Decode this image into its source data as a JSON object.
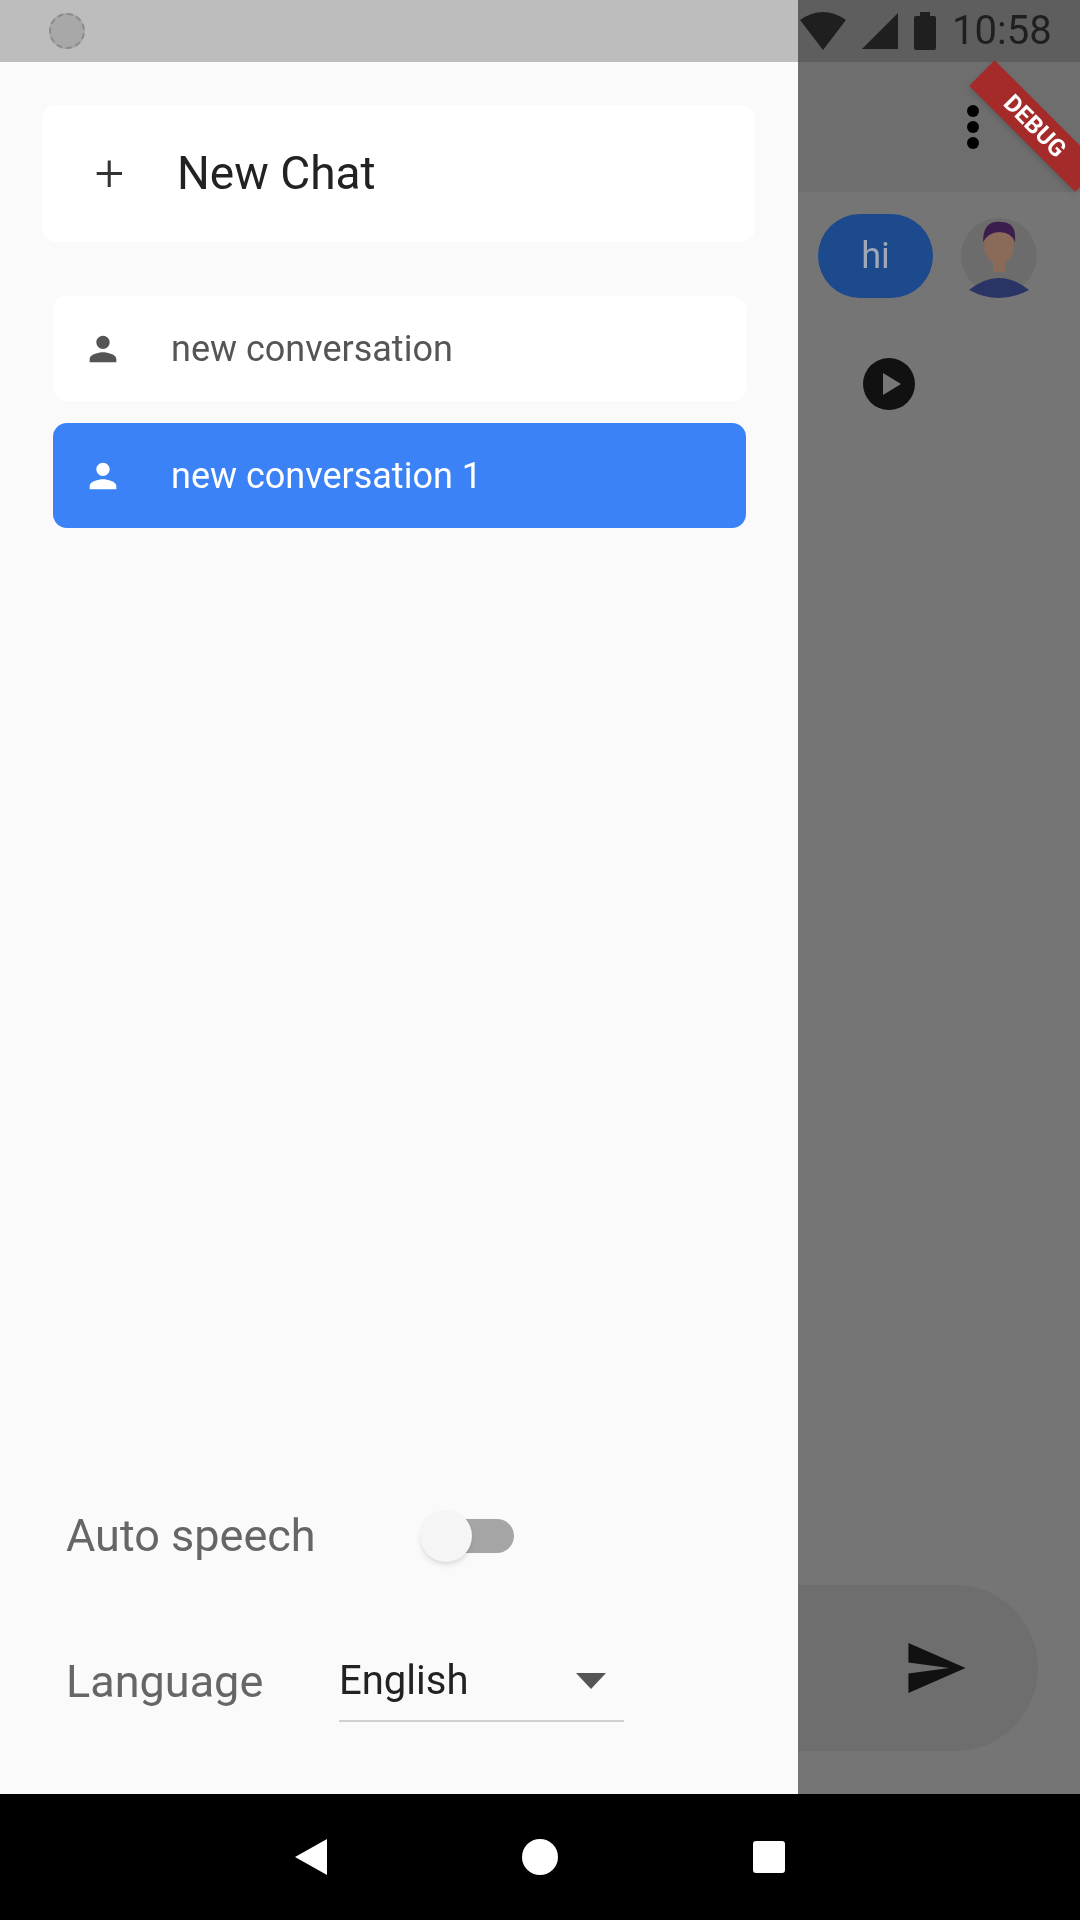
{
  "status_bar": {
    "time": "10:58"
  },
  "debug_banner": "DEBUG",
  "drawer": {
    "new_chat": {
      "label": "New Chat",
      "icon": "+"
    },
    "conversations": [
      {
        "title": "new conversation",
        "selected": false
      },
      {
        "title": "new conversation 1",
        "selected": true
      }
    ],
    "auto_speech": {
      "label": "Auto speech",
      "on": false
    },
    "language": {
      "label": "Language",
      "value": "English"
    }
  },
  "chat": {
    "messages": [
      {
        "text": "hi"
      }
    ]
  }
}
